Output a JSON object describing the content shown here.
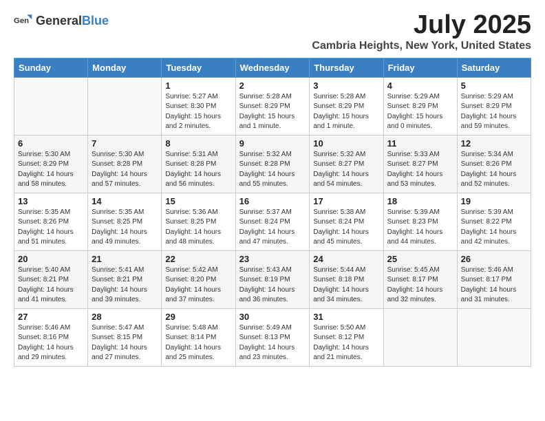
{
  "logo": {
    "general": "General",
    "blue": "Blue"
  },
  "title": "July 2025",
  "location": "Cambria Heights, New York, United States",
  "days_of_week": [
    "Sunday",
    "Monday",
    "Tuesday",
    "Wednesday",
    "Thursday",
    "Friday",
    "Saturday"
  ],
  "weeks": [
    [
      {
        "day": null
      },
      {
        "day": null
      },
      {
        "day": "1",
        "sunrise": "5:27 AM",
        "sunset": "8:30 PM",
        "daylight": "15 hours and 2 minutes."
      },
      {
        "day": "2",
        "sunrise": "5:28 AM",
        "sunset": "8:29 PM",
        "daylight": "15 hours and 1 minute."
      },
      {
        "day": "3",
        "sunrise": "5:28 AM",
        "sunset": "8:29 PM",
        "daylight": "15 hours and 1 minute."
      },
      {
        "day": "4",
        "sunrise": "5:29 AM",
        "sunset": "8:29 PM",
        "daylight": "15 hours and 0 minutes."
      },
      {
        "day": "5",
        "sunrise": "5:29 AM",
        "sunset": "8:29 PM",
        "daylight": "14 hours and 59 minutes."
      }
    ],
    [
      {
        "day": "6",
        "sunrise": "5:30 AM",
        "sunset": "8:29 PM",
        "daylight": "14 hours and 58 minutes."
      },
      {
        "day": "7",
        "sunrise": "5:30 AM",
        "sunset": "8:28 PM",
        "daylight": "14 hours and 57 minutes."
      },
      {
        "day": "8",
        "sunrise": "5:31 AM",
        "sunset": "8:28 PM",
        "daylight": "14 hours and 56 minutes."
      },
      {
        "day": "9",
        "sunrise": "5:32 AM",
        "sunset": "8:28 PM",
        "daylight": "14 hours and 55 minutes."
      },
      {
        "day": "10",
        "sunrise": "5:32 AM",
        "sunset": "8:27 PM",
        "daylight": "14 hours and 54 minutes."
      },
      {
        "day": "11",
        "sunrise": "5:33 AM",
        "sunset": "8:27 PM",
        "daylight": "14 hours and 53 minutes."
      },
      {
        "day": "12",
        "sunrise": "5:34 AM",
        "sunset": "8:26 PM",
        "daylight": "14 hours and 52 minutes."
      }
    ],
    [
      {
        "day": "13",
        "sunrise": "5:35 AM",
        "sunset": "8:26 PM",
        "daylight": "14 hours and 51 minutes."
      },
      {
        "day": "14",
        "sunrise": "5:35 AM",
        "sunset": "8:25 PM",
        "daylight": "14 hours and 49 minutes."
      },
      {
        "day": "15",
        "sunrise": "5:36 AM",
        "sunset": "8:25 PM",
        "daylight": "14 hours and 48 minutes."
      },
      {
        "day": "16",
        "sunrise": "5:37 AM",
        "sunset": "8:24 PM",
        "daylight": "14 hours and 47 minutes."
      },
      {
        "day": "17",
        "sunrise": "5:38 AM",
        "sunset": "8:24 PM",
        "daylight": "14 hours and 45 minutes."
      },
      {
        "day": "18",
        "sunrise": "5:39 AM",
        "sunset": "8:23 PM",
        "daylight": "14 hours and 44 minutes."
      },
      {
        "day": "19",
        "sunrise": "5:39 AM",
        "sunset": "8:22 PM",
        "daylight": "14 hours and 42 minutes."
      }
    ],
    [
      {
        "day": "20",
        "sunrise": "5:40 AM",
        "sunset": "8:21 PM",
        "daylight": "14 hours and 41 minutes."
      },
      {
        "day": "21",
        "sunrise": "5:41 AM",
        "sunset": "8:21 PM",
        "daylight": "14 hours and 39 minutes."
      },
      {
        "day": "22",
        "sunrise": "5:42 AM",
        "sunset": "8:20 PM",
        "daylight": "14 hours and 37 minutes."
      },
      {
        "day": "23",
        "sunrise": "5:43 AM",
        "sunset": "8:19 PM",
        "daylight": "14 hours and 36 minutes."
      },
      {
        "day": "24",
        "sunrise": "5:44 AM",
        "sunset": "8:18 PM",
        "daylight": "14 hours and 34 minutes."
      },
      {
        "day": "25",
        "sunrise": "5:45 AM",
        "sunset": "8:17 PM",
        "daylight": "14 hours and 32 minutes."
      },
      {
        "day": "26",
        "sunrise": "5:46 AM",
        "sunset": "8:17 PM",
        "daylight": "14 hours and 31 minutes."
      }
    ],
    [
      {
        "day": "27",
        "sunrise": "5:46 AM",
        "sunset": "8:16 PM",
        "daylight": "14 hours and 29 minutes."
      },
      {
        "day": "28",
        "sunrise": "5:47 AM",
        "sunset": "8:15 PM",
        "daylight": "14 hours and 27 minutes."
      },
      {
        "day": "29",
        "sunrise": "5:48 AM",
        "sunset": "8:14 PM",
        "daylight": "14 hours and 25 minutes."
      },
      {
        "day": "30",
        "sunrise": "5:49 AM",
        "sunset": "8:13 PM",
        "daylight": "14 hours and 23 minutes."
      },
      {
        "day": "31",
        "sunrise": "5:50 AM",
        "sunset": "8:12 PM",
        "daylight": "14 hours and 21 minutes."
      },
      {
        "day": null
      },
      {
        "day": null
      }
    ]
  ]
}
